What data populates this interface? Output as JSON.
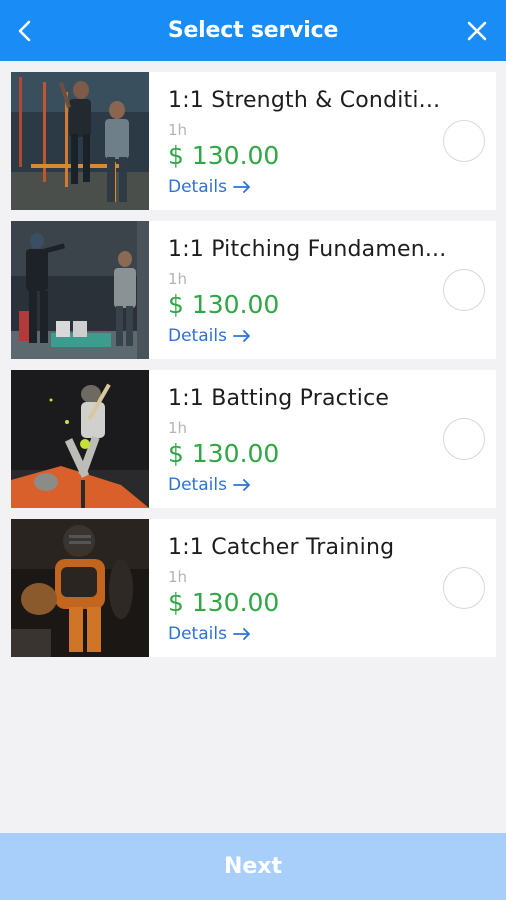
{
  "header": {
    "title": "Select service",
    "back_icon": "chevron-left-icon",
    "close_icon": "close-icon"
  },
  "colors": {
    "header_bg": "#1a8cf5",
    "price": "#2fa844",
    "link": "#2d72d9",
    "footer_bg": "#a8cffa"
  },
  "services": [
    {
      "name": "1:1 Strength & Conditi...",
      "duration": "1h",
      "price": "$ 130.00",
      "details": "Details",
      "selected": false
    },
    {
      "name": "1:1 Pitching Fundamen...",
      "duration": "1h",
      "price": "$ 130.00",
      "details": "Details",
      "selected": false
    },
    {
      "name": "1:1 Batting Practice",
      "duration": "1h",
      "price": "$ 130.00",
      "details": "Details",
      "selected": false
    },
    {
      "name": "1:1 Catcher Training",
      "duration": "1h",
      "price": "$ 130.00",
      "details": "Details",
      "selected": false
    }
  ],
  "footer": {
    "next_label": "Next"
  }
}
